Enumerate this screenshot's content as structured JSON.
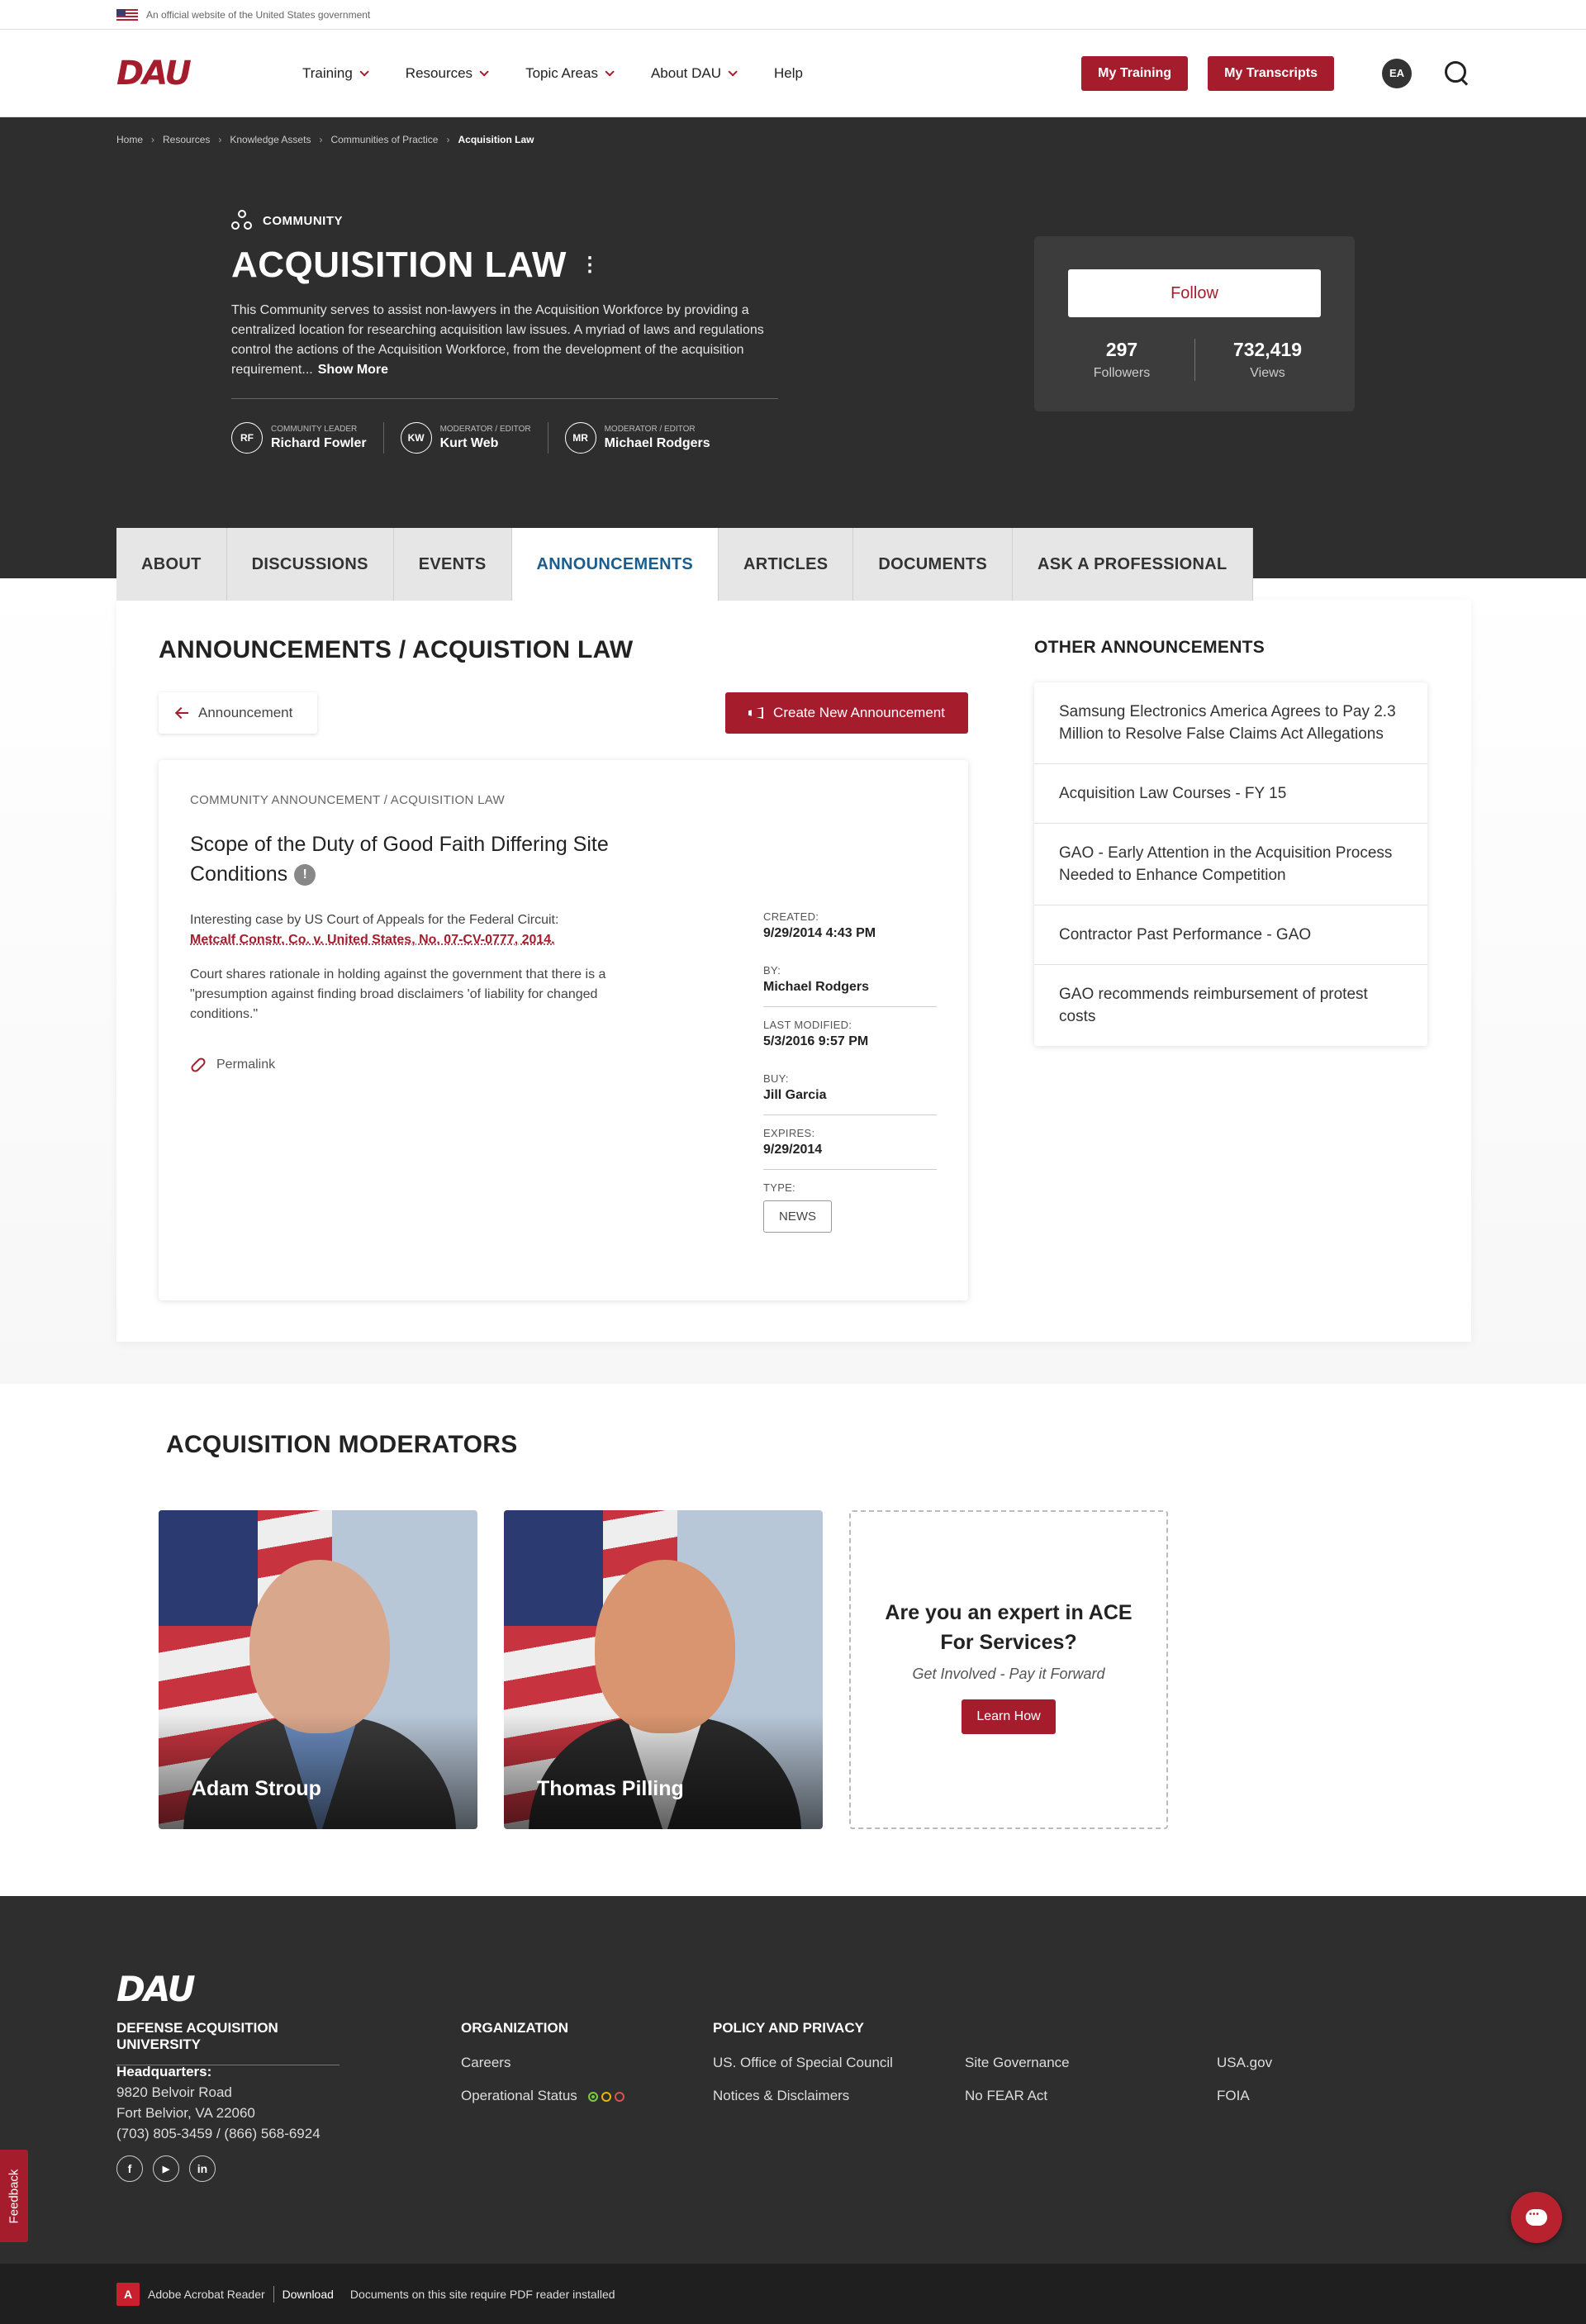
{
  "gov_banner": {
    "text": "An official website of the United States government"
  },
  "header": {
    "logo": "DAU",
    "nav": [
      "Training",
      "Resources",
      "Topic Areas",
      "About DAU",
      "Help"
    ],
    "my_training": "My Training",
    "my_transcripts": "My Transcripts",
    "user_initials": "EA"
  },
  "breadcrumb": [
    "Home",
    "Resources",
    "Knowledge Assets",
    "Communities of Practice",
    "Acquisition Law"
  ],
  "hero": {
    "tag": "COMMUNITY",
    "title": "ACQUISITION LAW",
    "description": "This Community serves to assist non-lawyers in the Acquisition Workforce by providing a centralized location for researching acquisition law issues. A myriad of laws and regulations control the actions of the Acquisition Workforce, from the development of the acquisition requirement...",
    "show_more": "Show More",
    "leaders": [
      {
        "initials": "RF",
        "role": "COMMUNITY LEADER",
        "name": "Richard Fowler"
      },
      {
        "initials": "KW",
        "role": "MODERATOR / EDITOR",
        "name": "Kurt Web"
      },
      {
        "initials": "MR",
        "role": "MODERATOR / EDITOR",
        "name": "Michael Rodgers"
      }
    ]
  },
  "follow_card": {
    "follow_label": "Follow",
    "followers": "297",
    "followers_label": "Followers",
    "views": "732,419",
    "views_label": "Views"
  },
  "tabs": [
    "ABOUT",
    "DISCUSSIONS",
    "EVENTS",
    "ANNOUNCEMENTS",
    "ARTICLES",
    "DOCUMENTS",
    "ASK A PROFESSIONAL"
  ],
  "active_tab": "ANNOUNCEMENTS",
  "main": {
    "section_title": "ANNOUNCEMENTS / ACQUISTION LAW",
    "back_label": "Announcement",
    "create_label": "Create New Announcement"
  },
  "announcement": {
    "crumb": "COMMUNITY ANNOUNCEMENT / ACQUISITION LAW",
    "title": "Scope of the Duty of Good Faith Differing Site Conditions",
    "body_intro": "Interesting case by US Court of Appeals for the Federal Circuit:",
    "body_link": "Metcalf Constr. Co. v. United States, No. 07-CV-0777, 2014.",
    "body_p2": "Court shares rationale in holding against the government that there is a \"presumption against finding broad disclaimers 'of liability for changed conditions.\"",
    "permalink": "Permalink",
    "meta": [
      {
        "label": "CREATED:",
        "value": "9/29/2014 4:43 PM"
      },
      {
        "label": "BY:",
        "value": "Michael Rodgers"
      },
      {
        "label": "LAST MODIFIED:",
        "value": "5/3/2016 9:57 PM"
      },
      {
        "label": "BUY:",
        "value": "Jill Garcia"
      },
      {
        "label": "EXPIRES:",
        "value": "9/29/2014"
      }
    ],
    "type_label": "TYPE:",
    "type_value": "NEWS"
  },
  "other": {
    "title": "OTHER ANNOUNCEMENTS",
    "items": [
      "Samsung Electronics America Agrees to Pay 2.3 Million to Resolve False Claims Act Allegations",
      "Acquisition Law Courses - FY 15",
      "GAO - Early Attention in the Acquisition Process Needed to Enhance Competition",
      "Contractor Past Performance - GAO",
      "GAO recommends reimbursement of protest costs"
    ]
  },
  "moderators": {
    "title": "ACQUISITION MODERATORS",
    "people": [
      "Adam Stroup",
      "Thomas Pilling"
    ],
    "expert_title": "Are you an expert in ACE For Services?",
    "expert_sub": "Get Involved - Pay it Forward",
    "learn_label": "Learn How"
  },
  "footer": {
    "logo": "DAU",
    "university": "DEFENSE ACQUISITION UNIVERSITY",
    "hq_label": "Headquarters:",
    "address1": "9820 Belvoir Road",
    "address2": "Fort Belvior, VA 22060",
    "phone": "(703) 805-3459 / (866) 568-6924",
    "social": [
      "f",
      "▶",
      "in"
    ],
    "org_title": "ORGANIZATION",
    "careers": "Careers",
    "op_status": "Operational Status",
    "status_colors": [
      "#7ac943",
      "#e6b800",
      "#d9534f"
    ],
    "policy_title": "POLICY AND PRIVACY",
    "links_col1": [
      "US. Office of Special Council",
      "Notices & Disclaimers"
    ],
    "links_col2": [
      "Site Governance",
      "No FEAR Act"
    ],
    "links_col3": [
      "USA.gov",
      "FOIA"
    ]
  },
  "feedback": "Feedback",
  "pdf_bar": {
    "reader": "Adobe Acrobat Reader",
    "download": "Download",
    "note": "Documents on this site require PDF reader installed"
  },
  "colors": {
    "brand_red": "#a51d2d",
    "active_tab": "#1a5d8f",
    "hero_bg": "#2e2e2e"
  }
}
